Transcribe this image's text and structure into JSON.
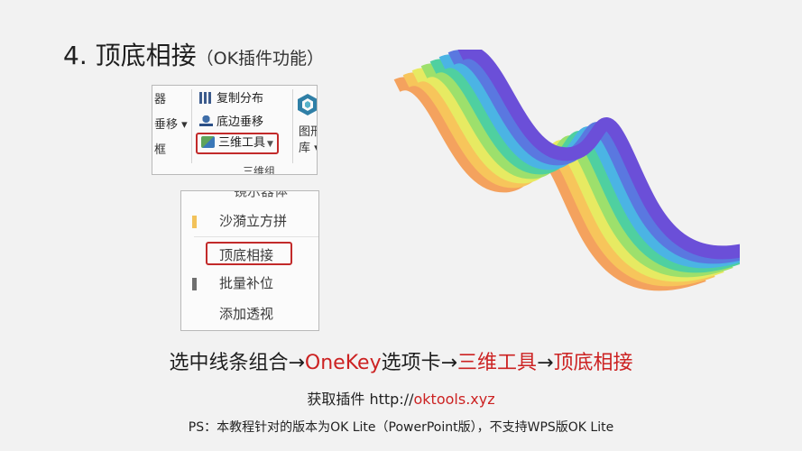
{
  "slide": {
    "title": "4. 顶底相接",
    "title_sub": "（OK插件功能）",
    "caption_parts": [
      "选中线条组合→",
      "OneKey",
      "选项卡→",
      "三维工具",
      "→",
      "顶底相接"
    ],
    "link_prefix": "获取插件 http://",
    "link_host": "oktools.xyz",
    "ps_note": "PS：本教程针对的版本为OK Lite（PowerPoint版），不支持WPS版OK Lite"
  },
  "ribbon": {
    "left_fragments": [
      "器",
      "垂移 ▾",
      "框"
    ],
    "items": [
      "复制分布",
      "底边垂移",
      "三维工具"
    ],
    "group_label": "三维组",
    "right_fragments": [
      "图形",
      "库 ▾"
    ]
  },
  "menu": {
    "cut_item": "镜示器体",
    "items": [
      "沙漪立方拼",
      "顶底相接",
      "批量补位",
      "添加透视"
    ]
  },
  "colors": {
    "accent_red": "#cc2222",
    "highlight_border": "#c22a2a",
    "rainbow": [
      "#f4a25e",
      "#f7c55b",
      "#e7ea62",
      "#9de06c",
      "#4fd0a0",
      "#4bb4e4",
      "#5a78e0",
      "#6b4fd8"
    ]
  },
  "icons": [
    "copy-distribute-icon",
    "bottom-shift-icon",
    "cube-icon",
    "hexagon-icon"
  ]
}
